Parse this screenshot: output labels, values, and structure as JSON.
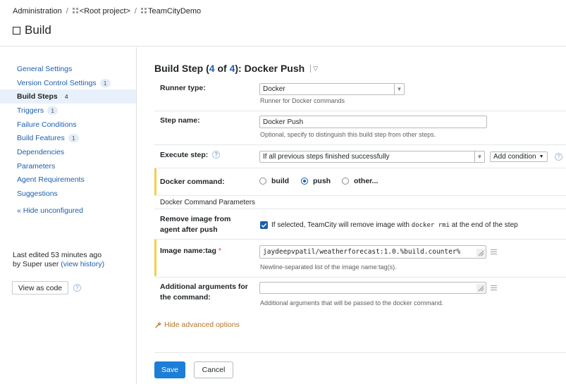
{
  "breadcrumb": {
    "items": [
      "Administration",
      "<Root project>",
      "TeamCityDemo"
    ]
  },
  "page": {
    "title": "Build"
  },
  "sidebar": {
    "items": [
      {
        "label": "General Settings",
        "badge": ""
      },
      {
        "label": "Version Control Settings",
        "badge": "1"
      },
      {
        "label": "Build Steps",
        "badge": "4",
        "active": true
      },
      {
        "label": "Triggers",
        "badge": "1"
      },
      {
        "label": "Failure Conditions",
        "badge": ""
      },
      {
        "label": "Build Features",
        "badge": "1"
      },
      {
        "label": "Dependencies",
        "badge": ""
      },
      {
        "label": "Parameters",
        "badge": ""
      },
      {
        "label": "Agent Requirements",
        "badge": ""
      },
      {
        "label": "Suggestions",
        "badge": ""
      }
    ],
    "hide_unconfigured": "« Hide unconfigured",
    "last_edited_line1": "Last edited 53 minutes ago",
    "last_edited_by": "by Super user",
    "view_history": "(view history)",
    "view_as_code": "View as code"
  },
  "step": {
    "heading_prefix": "Build Step (",
    "heading_current": "4",
    "heading_of": " of ",
    "heading_total": "4",
    "heading_suffix": "): Docker Push",
    "runner_type_label": "Runner type:",
    "runner_type_value": "Docker",
    "runner_type_note": "Runner for Docker commands",
    "step_name_label": "Step name:",
    "step_name_value": "Docker Push",
    "step_name_note": "Optional, specify to distinguish this build step from other steps.",
    "execute_step_label": "Execute step:",
    "execute_step_value": "If all previous steps finished successfully",
    "add_condition": "Add condition",
    "docker_command_label": "Docker command:",
    "docker_command_options": [
      "build",
      "push",
      "other..."
    ],
    "docker_command_selected": "push",
    "params_section": "Docker Command Parameters",
    "remove_image_label": "Remove image from agent after push",
    "remove_image_checked": true,
    "remove_image_text_a": "If selected, TeamCity will remove image with",
    "remove_image_code": "docker rmi",
    "remove_image_text_b": "at the end of the step",
    "image_name_label": "Image name:tag",
    "image_name_required": "*",
    "image_name_value": "jaydeepvpatil/weatherforecast:1.0.%build.counter%",
    "image_name_note": "Newline-separated list of the image name:tag(s).",
    "additional_args_label": "Additional arguments for the command:",
    "additional_args_value": "",
    "additional_args_note": "Additional arguments that will be passed to the docker command.",
    "hide_advanced": "Hide advanced options",
    "save": "Save",
    "cancel": "Cancel"
  },
  "colors": {
    "link": "#1c5fad",
    "primary_button": "#1c7ed6",
    "highlight_bar": "#f6cf4b",
    "active_nav_bg": "#e8f1fb",
    "advanced_link": "#b8742a"
  }
}
